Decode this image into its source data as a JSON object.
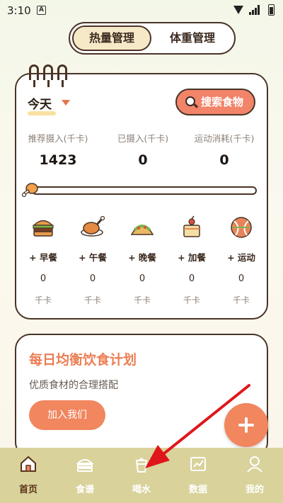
{
  "status_bar": {
    "time": "3:10",
    "app_icon_letter": "A"
  },
  "tab_switch": {
    "active": "热量管理",
    "inactive": "体重管理"
  },
  "today": {
    "label": "今天"
  },
  "search": {
    "label": "搜索食物"
  },
  "stats": [
    {
      "label": "推荐摄入(千卡)",
      "value": "1423"
    },
    {
      "label": "已摄入(千卡)",
      "value": "0"
    },
    {
      "label": "运动消耗(千卡)",
      "value": "0"
    }
  ],
  "progress": {
    "fraction": 0.0
  },
  "meals": [
    {
      "icon": "burger-icon",
      "name": "+ 早餐",
      "value": "0",
      "unit": "千卡"
    },
    {
      "icon": "roast-chicken-icon",
      "name": "+ 午餐",
      "value": "0",
      "unit": "千卡"
    },
    {
      "icon": "taco-icon",
      "name": "+ 晚餐",
      "value": "0",
      "unit": "千卡"
    },
    {
      "icon": "cake-icon",
      "name": "+ 加餐",
      "value": "0",
      "unit": "千卡"
    },
    {
      "icon": "ball-icon",
      "name": "+ 运动",
      "value": "0",
      "unit": "千卡"
    }
  ],
  "plan": {
    "title": "每日均衡饮食计划",
    "subtitle": "优质食材的合理搭配",
    "join_label": "加入我们"
  },
  "nav": [
    {
      "icon": "home-icon",
      "label": "首页",
      "active": true
    },
    {
      "icon": "recipe-icon",
      "label": "食谱",
      "active": false
    },
    {
      "icon": "drink-icon",
      "label": "喝水",
      "active": false
    },
    {
      "icon": "chart-icon",
      "label": "数据",
      "active": false
    },
    {
      "icon": "profile-icon",
      "label": "我的",
      "active": false
    }
  ],
  "colors": {
    "accent": "#f1865f",
    "nav_bg": "#d9d29b",
    "border": "#4a3426"
  }
}
